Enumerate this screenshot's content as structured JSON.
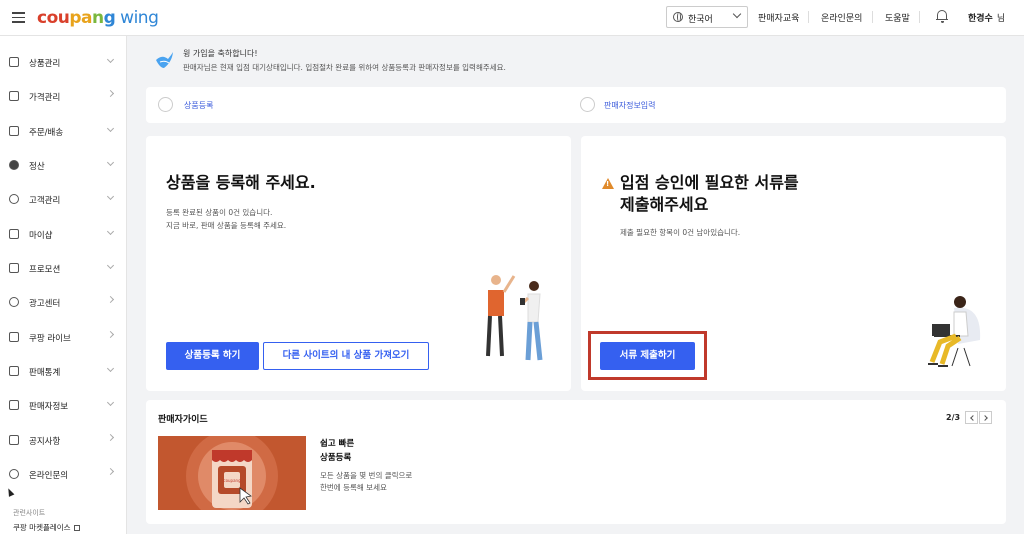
{
  "header": {
    "logo": {
      "c1": "cou",
      "c2": "pa",
      "c3": "n",
      "c4": "g",
      "wing": " wing"
    },
    "language": "한국어",
    "links": [
      "판매자교육",
      "온라인문의",
      "도움말"
    ],
    "user_name": "한경수",
    "user_suffix": "님"
  },
  "sidebar": {
    "items": [
      {
        "label": "상품관리",
        "icon": "box-icon",
        "chevron": "down"
      },
      {
        "label": "가격관리",
        "icon": "medal-icon",
        "chevron": "right"
      },
      {
        "label": "주문/배송",
        "icon": "truck-icon",
        "chevron": "down"
      },
      {
        "label": "정산",
        "icon": "won-icon",
        "chevron": "down"
      },
      {
        "label": "고객관리",
        "icon": "smile-icon",
        "chevron": "down"
      },
      {
        "label": "마이샵",
        "icon": "shop-icon",
        "chevron": "down"
      },
      {
        "label": "프로모션",
        "icon": "coupon-icon",
        "chevron": "down"
      },
      {
        "label": "광고센터",
        "icon": "ad-icon",
        "chevron": "right"
      },
      {
        "label": "쿠팡 라이브",
        "icon": "live-icon",
        "chevron": "right"
      },
      {
        "label": "판매통계",
        "icon": "stats-icon",
        "chevron": "down"
      },
      {
        "label": "판매자정보",
        "icon": "person-icon",
        "chevron": "down"
      },
      {
        "label": "공지사항",
        "icon": "megaphone-icon",
        "chevron": "right"
      },
      {
        "label": "온라인문의",
        "icon": "headset-icon",
        "chevron": "right"
      }
    ],
    "footer_title": "관련사이트",
    "footer_link": "쿠팡 마켓플레이스"
  },
  "banner": {
    "title": "윙 가입을 축하합니다!",
    "desc": "판매자님은 현재 입점 대기상태입니다. 입점절차 완료를 위하여 상품등록과 판매자정보를 입력해주세요."
  },
  "steps": [
    "상품등록",
    "판매자정보입력"
  ],
  "card_left": {
    "title": "상품을 등록해 주세요.",
    "desc1": "등록 완료된 상품이 0건 있습니다.",
    "desc2": "지금 바로, 판매 상품을 등록해 주세요.",
    "btn_primary": "상품등록 하기",
    "btn_outline": "다른 사이트의 내 상품 가져오기"
  },
  "card_right": {
    "title1": "입점 승인에 필요한 서류를",
    "title2": "제출해주세요",
    "desc": "제출 필요한 항목이 0건 남아있습니다.",
    "btn_primary": "서류 제출하기"
  },
  "guide": {
    "title": "판매자가이드",
    "pager": "2/3",
    "heading1": "쉽고 빠른",
    "heading2": "상품등록",
    "desc1": "모든 상품을 몇 번의 클릭으로",
    "desc2": "한번에 등록해 보세요",
    "thumb_brand": "coupang"
  },
  "colors": {
    "primary": "#3560f0",
    "highlight": "#c0392b",
    "warning": "#e08a2b"
  }
}
